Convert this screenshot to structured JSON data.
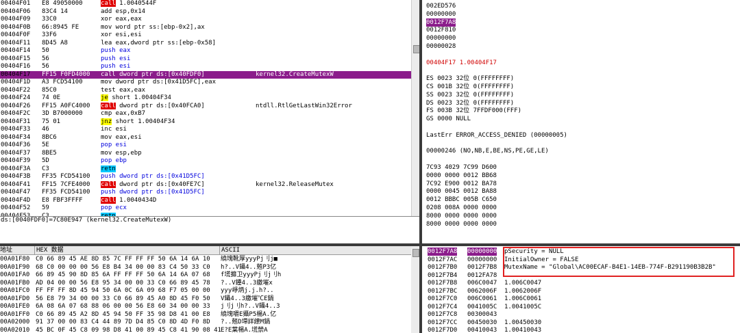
{
  "disasm": [
    {
      "addr": "00404F01",
      "hex": "E8 49050000",
      "asm": "call 1.0040544F",
      "kw": "call",
      "cmt": ""
    },
    {
      "addr": "00404F06",
      "hex": "83C4 14",
      "asm": "add esp,0x14",
      "kw": "",
      "cmt": ""
    },
    {
      "addr": "00404F09",
      "hex": "33C0",
      "asm": "xor eax,eax",
      "kw": "",
      "cmt": ""
    },
    {
      "addr": "00404F0B",
      "hex": "66:8945 FE",
      "asm": "mov word ptr ss:[ebp-0x2],ax",
      "kw": "",
      "cmt": ""
    },
    {
      "addr": "00404F0F",
      "hex": "33F6",
      "asm": "xor esi,esi",
      "kw": "",
      "cmt": ""
    },
    {
      "addr": "00404F11",
      "hex": "8D45 A8",
      "asm": "lea eax,dword ptr ss:[ebp-0x58]",
      "kw": "",
      "cmt": ""
    },
    {
      "addr": "00404F14",
      "hex": "50",
      "asm": "push eax",
      "kw": "push",
      "cmt": ""
    },
    {
      "addr": "00404F15",
      "hex": "56",
      "asm": "push esi",
      "kw": "push",
      "cmt": ""
    },
    {
      "addr": "00404F16",
      "hex": "56",
      "asm": "push esi",
      "kw": "push",
      "cmt": ""
    },
    {
      "addr": "00404F17",
      "hex": "FF15 F0FD4000",
      "asm": "call dword ptr ds:[0x40FDF0]",
      "kw": "call",
      "cmt": "kernel32.CreateMutexW",
      "hl": true
    },
    {
      "addr": "00404F1D",
      "hex": "A3 FCD54100",
      "asm": "mov dword ptr ds:[0x41D5FC],eax",
      "kw": "",
      "cmt": ""
    },
    {
      "addr": "00404F22",
      "hex": "85C0",
      "asm": "test eax,eax",
      "kw": "",
      "cmt": ""
    },
    {
      "addr": "00404F24",
      "hex": "74 0E",
      "asm": "je short 1.00404F34",
      "kw": "jmp",
      "cmt": ""
    },
    {
      "addr": "00404F26",
      "hex": "FF15 A0FC4000",
      "asm": "call dword ptr ds:[0x40FCA0]",
      "kw": "call",
      "cmt": "ntdll.RtlGetLastWin32Error"
    },
    {
      "addr": "00404F2C",
      "hex": "3D B7000000",
      "asm": "cmp eax,0xB7",
      "kw": "",
      "cmt": ""
    },
    {
      "addr": "00404F31",
      "hex": "75 01",
      "asm": "jnz short 1.00404F34",
      "kw": "jmp",
      "cmt": ""
    },
    {
      "addr": "00404F33",
      "hex": "46",
      "asm": "inc esi",
      "kw": "",
      "cmt": ""
    },
    {
      "addr": "00404F34",
      "hex": "8BC6",
      "asm": "mov eax,esi",
      "kw": "",
      "cmt": ""
    },
    {
      "addr": "00404F36",
      "hex": "5E",
      "asm": "pop esi",
      "kw": "push",
      "cmt": ""
    },
    {
      "addr": "00404F37",
      "hex": "8BE5",
      "asm": "mov esp,ebp",
      "kw": "",
      "cmt": ""
    },
    {
      "addr": "00404F39",
      "hex": "5D",
      "asm": "pop ebp",
      "kw": "push",
      "cmt": ""
    },
    {
      "addr": "00404F3A",
      "hex": "C3",
      "asm": "retn",
      "kw": "ret",
      "cmt": ""
    },
    {
      "addr": "00404F3B",
      "hex": "FF35 FCD54100",
      "asm": "push dword ptr ds:[0x41D5FC]",
      "kw": "push",
      "cmt": ""
    },
    {
      "addr": "00404F41",
      "hex": "FF15 7CFE4000",
      "asm": "call dword ptr ds:[0x40FE7C]",
      "kw": "call",
      "cmt": "kernel32.ReleaseMutex"
    },
    {
      "addr": "00404F47",
      "hex": "FF35 FCD54100",
      "asm": "push dword ptr ds:[0x41D5FC]",
      "kw": "push",
      "cmt": ""
    },
    {
      "addr": "00404F4D",
      "hex": "E8 FBF3FFFF",
      "asm": "call 1.0040434D",
      "kw": "call",
      "cmt": ""
    },
    {
      "addr": "00404F52",
      "hex": "59",
      "asm": "pop ecx",
      "kw": "push",
      "cmt": ""
    },
    {
      "addr": "00404F53",
      "hex": "C3",
      "asm": "retn",
      "kw": "ret",
      "cmt": ""
    }
  ],
  "infoline": "ds:[0040FDF0]=7C80E947 (kernel32.CreateMutexW)",
  "registers": [
    {
      "text": "002ED576",
      "cls": ""
    },
    {
      "text": "00000000",
      "cls": ""
    },
    {
      "text": "0012F7A8",
      "cls": "hlbg"
    },
    {
      "text": "0012F810",
      "cls": ""
    },
    {
      "text": "00000000",
      "cls": ""
    },
    {
      "text": "00000028",
      "cls": ""
    },
    {
      "text": "",
      "cls": ""
    },
    {
      "text": "00404F17 1.00404F17",
      "cls": "eip"
    },
    {
      "text": "",
      "cls": ""
    },
    {
      "text": "ES 0023 32位 0(FFFFFFFF)",
      "cls": ""
    },
    {
      "text": "CS 001B 32位 0(FFFFFFFF)",
      "cls": ""
    },
    {
      "text": "SS 0023 32位 0(FFFFFFFF)",
      "cls": ""
    },
    {
      "text": "DS 0023 32位 0(FFFFFFFF)",
      "cls": ""
    },
    {
      "text": "FS 003B 32位 7FFDF000(FFF)",
      "cls": ""
    },
    {
      "text": "GS 0000 NULL",
      "cls": ""
    },
    {
      "text": "",
      "cls": ""
    },
    {
      "text": "LastErr ERROR_ACCESS_DENIED (00000005)",
      "cls": ""
    },
    {
      "text": "",
      "cls": ""
    },
    {
      "text": "00000246 (NO,NB,E,BE,NS,PE,GE,LE)",
      "cls": ""
    },
    {
      "text": "",
      "cls": ""
    },
    {
      "text": "7C93 4029 7C99 D600",
      "cls": ""
    },
    {
      "text": "0000 0000 0012 BB68",
      "cls": ""
    },
    {
      "text": "7C92 E900 0012 BA78",
      "cls": ""
    },
    {
      "text": "0000 0045 0012 BA88",
      "cls": ""
    },
    {
      "text": "0012 BBBC 005B C650",
      "cls": ""
    },
    {
      "text": "0208 008A 0000 0000",
      "cls": ""
    },
    {
      "text": "8000 0000 0000 0000",
      "cls": ""
    },
    {
      "text": "8000 0000 0000 0000",
      "cls": ""
    }
  ],
  "dump": {
    "col_addr": "地址",
    "col_hex": "HEX 数据",
    "col_ascii": "ASCII",
    "rows": [
      {
        "a": "00A01F80",
        "h": "C0 66 89 45 AE 8D 85 7C FF FF FF 50 6A 14 6A 10",
        "s": "繞塊靴厚yyyPj刂j■"
      },
      {
        "a": "00A01F90",
        "h": "68 C0 00 00 00 56 E8 B4 34 00 00 83 C4 50 33 C0",
        "s": "h?..V鑷4..兡P3亿"
      },
      {
        "a": "00A01FA0",
        "h": "66 89 45 90 8D 85 6A FF FF FF 50 6A 14 6A 07 68",
        "s": "f塃攠卫yyyPj刂j刂h"
      },
      {
        "a": "00A01FB0",
        "h": "AD 04 00 00 56 E8 95 34 00 00 33 C0 66 89 45 78",
        "s": "?..V鑸4..3繳墔x"
      },
      {
        "a": "00A01FC0",
        "h": "FF FF FF 8D 45 94 50 6A 0C 6A 09 68 F7 05 00 00",
        "s": "yyy崢炳j.j.h?.."
      },
      {
        "a": "00A01FD0",
        "h": "56 E8 79 34 00 00 33 C0 66 89 45 A0 8D 45 F0 50",
        "s": "V鑷4..3繳墔℃E鍋"
      },
      {
        "a": "00A01FE0",
        "h": "6A 08 6A 07 68 88 06 00 00 56 E8 60 34 00 00 33",
        "s": "j刂j刂h?..V鑷4..3"
      },
      {
        "a": "00A01FF0",
        "h": "C0 66 89 45 A2 8D 45 94 50 FF 35 98 D8 41 00 E8",
        "s": "繞塊嚼E攝P5楊A.亿"
      },
      {
        "a": "00A02000",
        "h": "91 37 00 00 83 C4 44 89 7D D4 85 C0 8D 4D F0 8D",
        "s": "?..兡D墆詳繚M鍋"
      },
      {
        "a": "00A02010",
        "h": "45 BC 0F 45 C8 09 98 D8 41 00 89 45 C8 41 90 08 41",
        "s": "E?E葉楊A.塃禜A"
      }
    ]
  },
  "stack": [
    {
      "a": "0012F7A8",
      "v": "00000000",
      "m": "pSecurity = NULL",
      "sel": true
    },
    {
      "a": "0012F7AC",
      "v": "00000000",
      "m": "InitialOwner = FALSE"
    },
    {
      "a": "0012F7B0",
      "v": "0012F7B8",
      "m": "MutexName = \"Global\\AC00ECAF-B4E1-14EB-774F-B291190B3B2B\""
    },
    {
      "a": "0012F7B4",
      "v": "0012FA78",
      "m": ""
    },
    {
      "a": "0012F7B8",
      "v": "006C0047",
      "m": "1.006C0047"
    },
    {
      "a": "0012F7BC",
      "v": "0062006F",
      "m": "1.0062006F"
    },
    {
      "a": "0012F7C0",
      "v": "006C0061",
      "m": "1.006C0061"
    },
    {
      "a": "0012F7C4",
      "v": "0041005C",
      "m": "1.0041005C"
    },
    {
      "a": "0012F7C8",
      "v": "00300043",
      "m": ""
    },
    {
      "a": "0012F7CC",
      "v": "00450030",
      "m": "1.00450030"
    },
    {
      "a": "0012F7D0",
      "v": "00410043",
      "m": "1.00410043"
    }
  ],
  "colors": {
    "highlight": "#8b1c8b",
    "call": "#e00000",
    "ret": "#00c8ff",
    "jmp": "#ffff00",
    "annotation": "#e02020"
  }
}
